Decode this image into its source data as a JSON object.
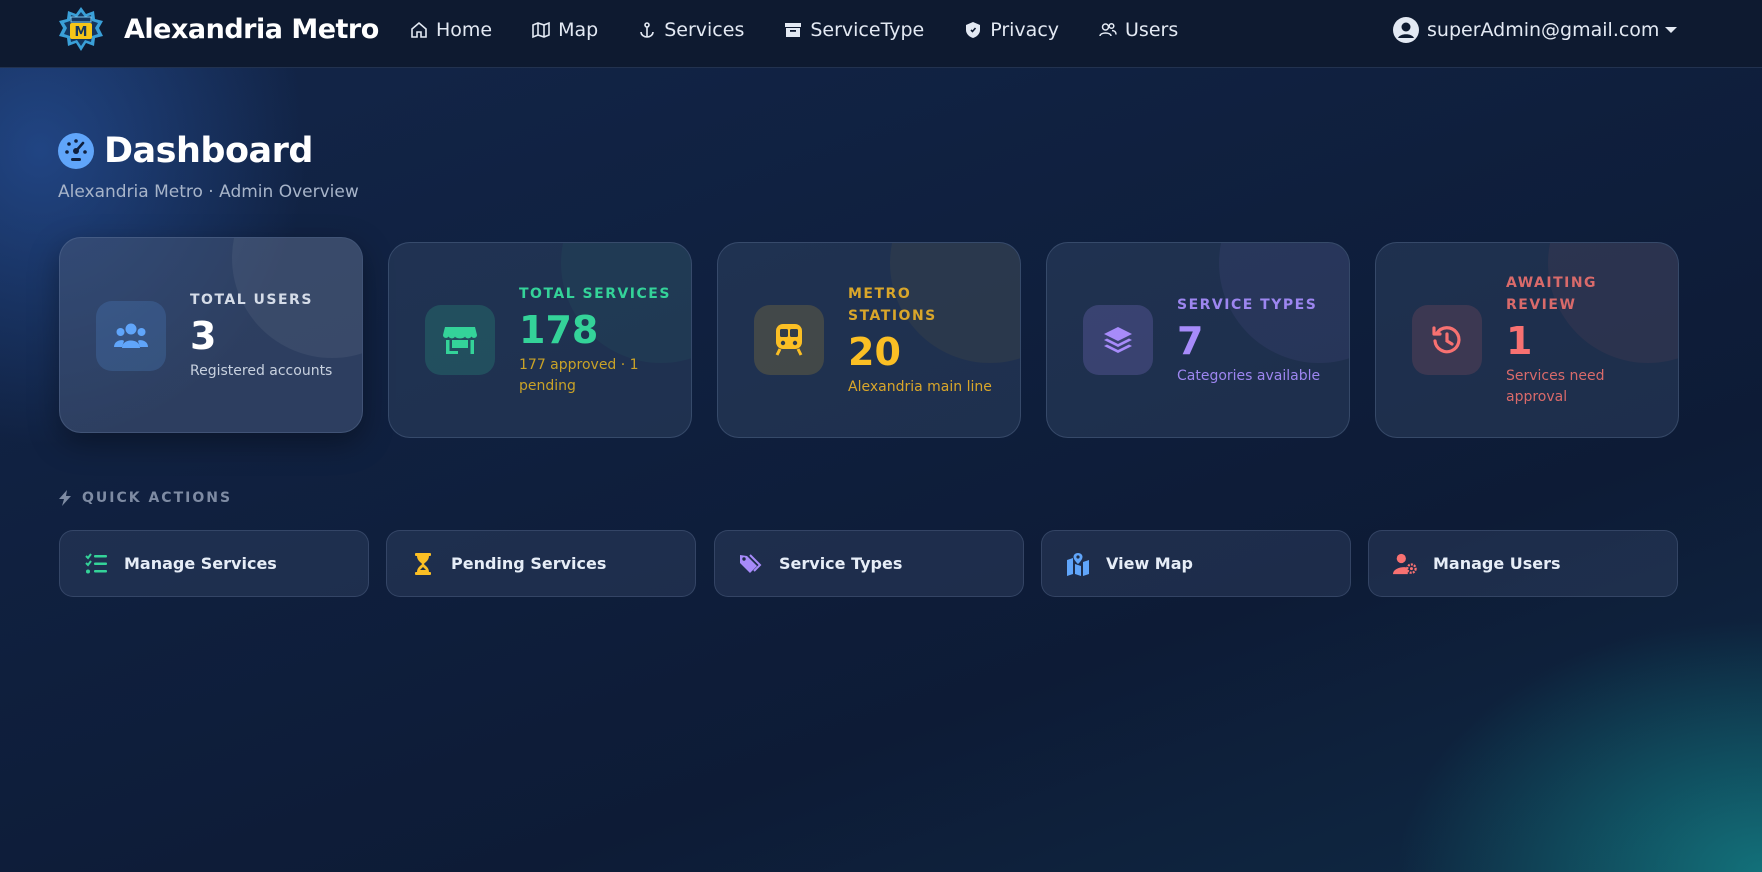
{
  "navbar": {
    "brand": "Alexandria Metro",
    "links": [
      {
        "label": "Home",
        "icon": "home-icon"
      },
      {
        "label": "Map",
        "icon": "map-icon"
      },
      {
        "label": "Services",
        "icon": "anchor-icon"
      },
      {
        "label": "ServiceType",
        "icon": "archive-icon"
      },
      {
        "label": "Privacy",
        "icon": "shield-icon"
      },
      {
        "label": "Users",
        "icon": "users-icon"
      }
    ],
    "user_email": "superAdmin@gmail.com"
  },
  "header": {
    "title": "Dashboard",
    "subtitle": "Alexandria Metro · Admin Overview"
  },
  "stats": [
    {
      "label": "TOTAL USERS",
      "value": "3",
      "sub": "Registered accounts",
      "icon": "users-icon",
      "color": "#60a5fa",
      "label_color": "#d5dce8",
      "sub_color": "#c8d1df",
      "value_color": "#ffffff"
    },
    {
      "label": "TOTAL SERVICES",
      "value": "178",
      "sub": "177 approved · 1 pending",
      "icon": "store-icon",
      "color": "#34d399",
      "label_color": "#34d399",
      "sub_color": "#c9a227",
      "value_color": "#34d399"
    },
    {
      "label": "METRO STATIONS",
      "value": "20",
      "sub": "Alexandria main line",
      "icon": "train-icon",
      "color": "#fbbf24",
      "label_color": "#d9a62a",
      "sub_color": "#d9a62a",
      "value_color": "#fbbf24"
    },
    {
      "label": "SERVICE TYPES",
      "value": "7",
      "sub": "Categories available",
      "icon": "layers-icon",
      "color": "#a78bfa",
      "label_color": "#9d86f0",
      "sub_color": "#9d86f0",
      "value_color": "#a78bfa"
    },
    {
      "label": "AWAITING REVIEW",
      "value": "1",
      "sub": "Services need approval",
      "icon": "history-icon",
      "color": "#f87171",
      "label_color": "#d96a6a",
      "sub_color": "#d96a6a",
      "value_color": "#f87171"
    }
  ],
  "quick_actions": {
    "heading": "QUICK ACTIONS",
    "items": [
      {
        "label": "Manage Services",
        "icon": "list-check-icon",
        "color": "#34d399"
      },
      {
        "label": "Pending Services",
        "icon": "hourglass-icon",
        "color": "#fbbf24"
      },
      {
        "label": "Service Types",
        "icon": "tags-icon",
        "color": "#a78bfa"
      },
      {
        "label": "View Map",
        "icon": "map-location-icon",
        "color": "#60a5fa"
      },
      {
        "label": "Manage Users",
        "icon": "user-gear-icon",
        "color": "#f87171"
      }
    ]
  }
}
